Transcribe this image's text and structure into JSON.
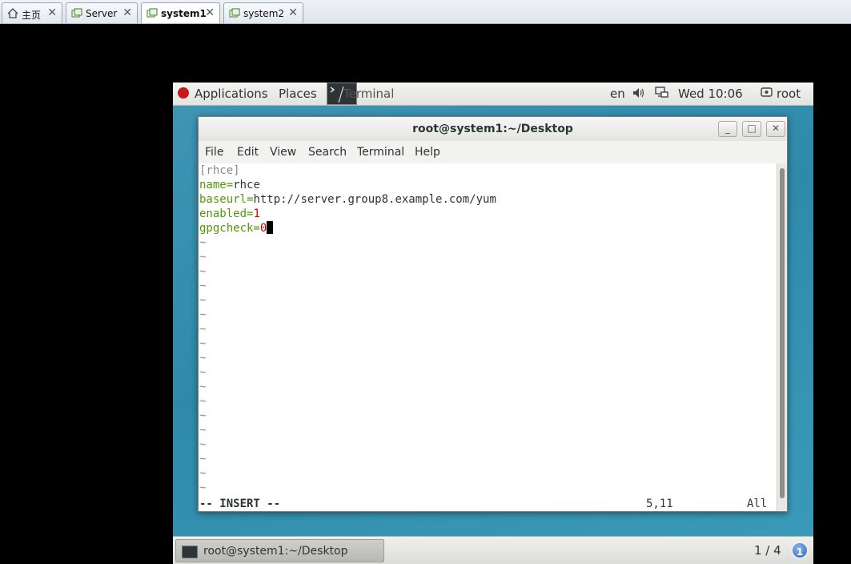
{
  "vm_tabs": [
    {
      "label": "主页",
      "icon": "home-icon",
      "active": false
    },
    {
      "label": "Server",
      "icon": "vm-icon",
      "active": false
    },
    {
      "label": "system1",
      "icon": "vm-icon",
      "active": true
    },
    {
      "label": "system2",
      "icon": "vm-icon",
      "active": false
    }
  ],
  "close_glyph": "✕",
  "top_panel": {
    "applications": "Applications",
    "places": "Places",
    "app_name": "Terminal",
    "lang": "en",
    "clock": "Wed 10:06",
    "user": "root"
  },
  "terminal": {
    "title": "root@system1:~/Desktop",
    "buttons": {
      "minimize": "_",
      "maximize": "□",
      "close": "✕"
    },
    "menu": [
      "File",
      "Edit",
      "View",
      "Search",
      "Terminal",
      "Help"
    ],
    "lines": {
      "section": "[rhce]",
      "name_key": "name=",
      "name_val": "rhce",
      "baseurl_key": "baseurl=",
      "baseurl_val": "http://server.group8.example.com/yum",
      "enabled_key": "enabled=",
      "enabled_val": "1",
      "gpgcheck_key": "gpgcheck=",
      "gpgcheck_val": "0"
    },
    "tilde": "~",
    "tilde_count": 18,
    "status": {
      "mode": "-- INSERT --",
      "position": "5,11",
      "scroll": "All"
    }
  },
  "bottom_panel": {
    "task_label": "root@system1:~/Desktop",
    "workspace": "1 / 4",
    "workspace_badge": "1"
  },
  "colors": {
    "keyword": "#4e9a06",
    "value_red": "#cc0000",
    "desktop": "#3b95b4"
  }
}
